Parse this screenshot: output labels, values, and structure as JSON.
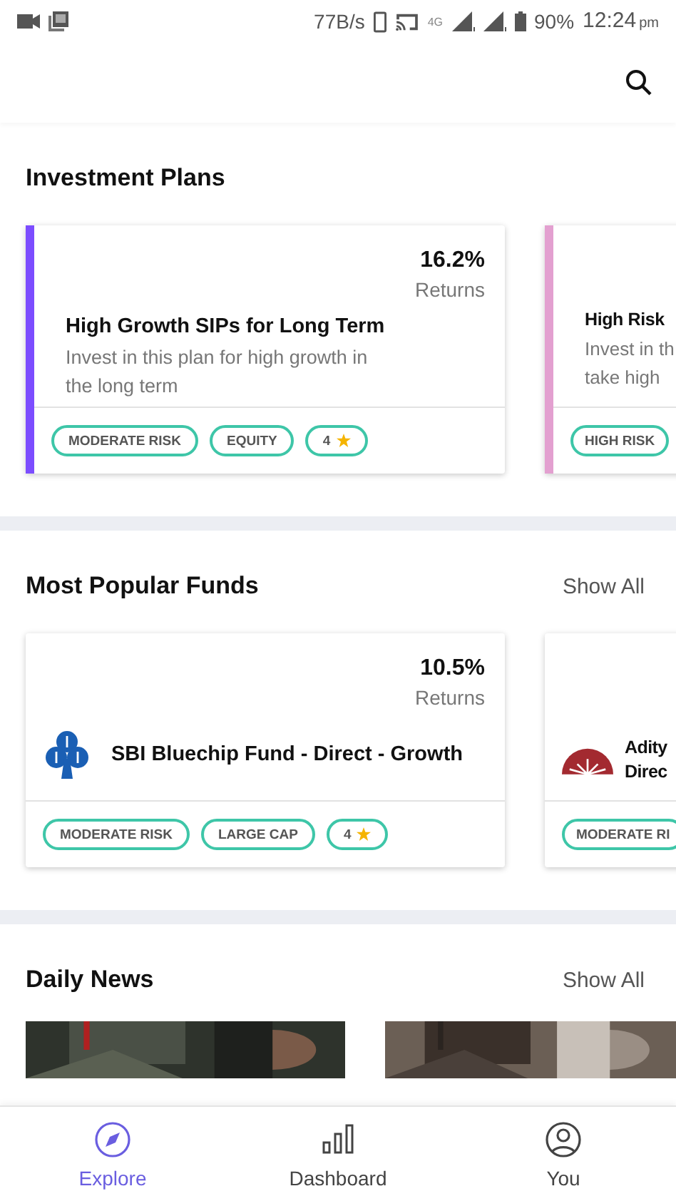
{
  "status_bar": {
    "speed": "77B/s",
    "network": "4G",
    "battery": "90%",
    "time": "12:24",
    "time_suffix": "pm"
  },
  "investment_plans": {
    "title": "Investment Plans",
    "plans": [
      {
        "color": "#7c4dff",
        "returns": "16.2%",
        "returns_label": "Returns",
        "title": "High Growth SIPs for Long Term",
        "description_lines": [
          "Invest in this plan for high growth in",
          "the long term"
        ],
        "tags": [
          "MODERATE RISK",
          "EQUITY"
        ],
        "rating": "4"
      },
      {
        "color": "#e3a0d0",
        "title": "High Risk",
        "description_lines": [
          "Invest in th",
          "take high"
        ],
        "tags": [
          "HIGH RISK"
        ]
      }
    ]
  },
  "popular_funds": {
    "title": "Most Popular Funds",
    "action": "Show All",
    "funds": [
      {
        "returns": "10.5%",
        "returns_label": "Returns",
        "name_lines": [
          "SBI Bluechip Fund - Direct - Growth"
        ],
        "tags": [
          "MODERATE RISK",
          "LARGE CAP"
        ],
        "rating": "4"
      },
      {
        "name_lines": [
          "Adity",
          "Direc"
        ],
        "tags": [
          "MODERATE RI"
        ]
      }
    ]
  },
  "daily_news": {
    "title": "Daily News",
    "action": "Show All"
  },
  "bottom_nav": [
    {
      "label": "Explore",
      "selected": true
    },
    {
      "label": "Dashboard",
      "selected": false
    },
    {
      "label": "You",
      "selected": false
    }
  ]
}
